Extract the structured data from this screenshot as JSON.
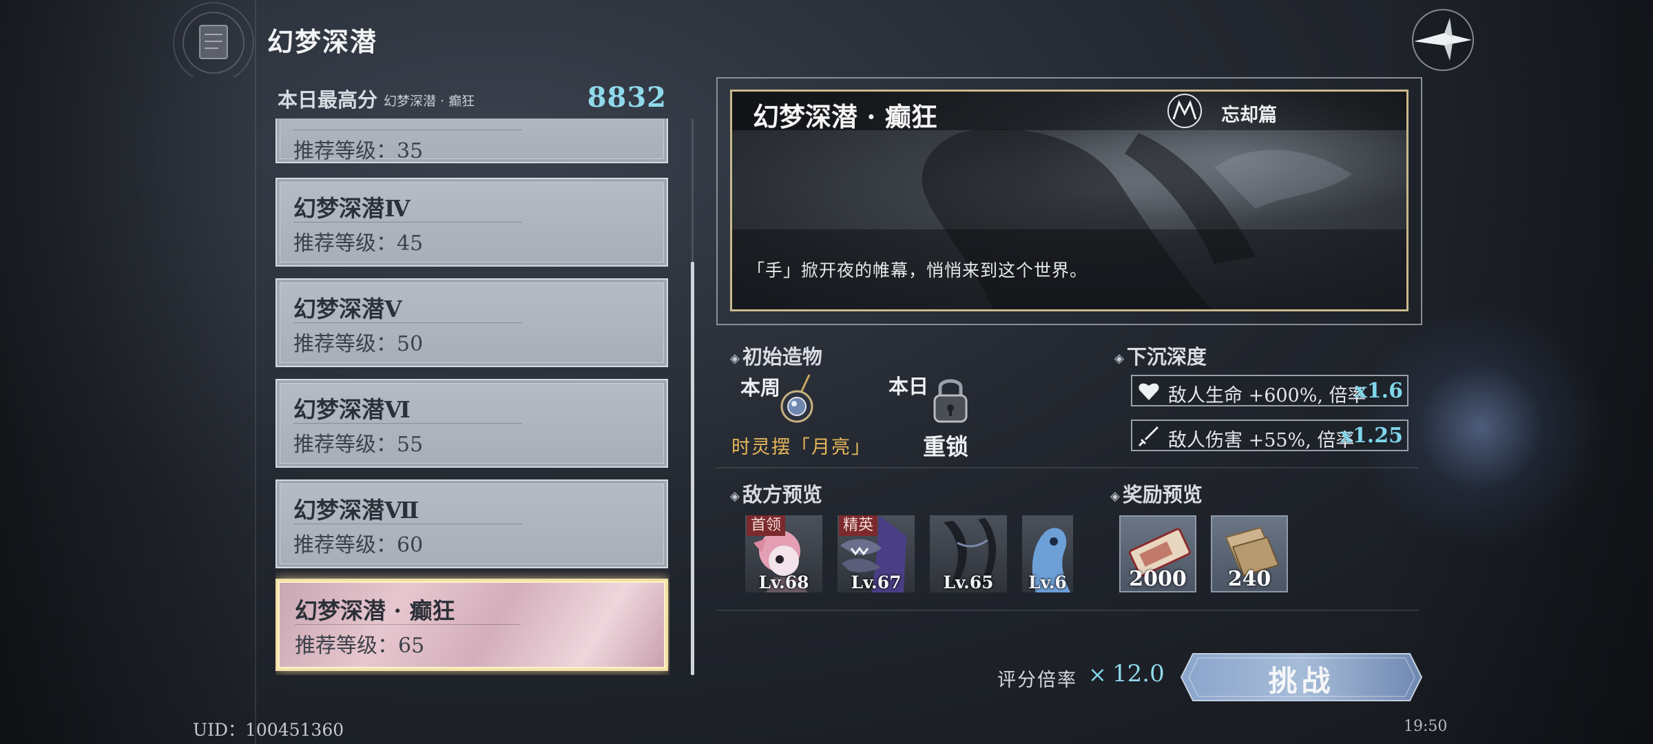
{
  "header": {
    "title": "幻梦深潜",
    "emblem_icon": "book-emblem-icon",
    "back_icon": "compass-back-icon"
  },
  "best_score": {
    "label": "本日最高分",
    "mode": "幻梦深潜 · 癫狂",
    "value": "8832"
  },
  "levels": [
    {
      "name": "",
      "level": "推荐等级：35"
    },
    {
      "name": "幻梦深潜Ⅳ",
      "level": "推荐等级：45"
    },
    {
      "name": "幻梦深潜Ⅴ",
      "level": "推荐等级：50"
    },
    {
      "name": "幻梦深潜Ⅵ",
      "level": "推荐等级：55"
    },
    {
      "name": "幻梦深潜Ⅶ",
      "level": "推荐等级：60"
    },
    {
      "name": "幻梦深潜 · 癫狂",
      "level": "推荐等级：65",
      "selected": true
    }
  ],
  "detail": {
    "title": "幻梦深潜 · 癫狂",
    "chapter": "忘却篇",
    "description": "「手」掀开夜的帷幕，悄悄来到这个世界。"
  },
  "artifacts": {
    "title": "初始造物",
    "weekly_label": "本周",
    "weekly_name": "时灵摆「月亮」",
    "daily_label": "本日",
    "daily_name": "重锁"
  },
  "depth": {
    "title": "下沉深度",
    "modifiers": [
      {
        "icon": "heart-icon",
        "text": "敌人生命 +600%, 倍率",
        "mult": "x1.6"
      },
      {
        "icon": "sword-icon",
        "text": "敌人伤害 +55%, 倍率",
        "mult": "x1.25"
      }
    ]
  },
  "enemies": {
    "title": "敌方预览",
    "items": [
      {
        "tag": "首领",
        "level": "Lv.68"
      },
      {
        "tag": "精英",
        "level": "Lv.67"
      },
      {
        "tag": "",
        "level": "Lv.65"
      },
      {
        "tag": "",
        "level": "Lv.6"
      }
    ]
  },
  "rewards": {
    "title": "奖励预览",
    "items": [
      {
        "qty": "2000"
      },
      {
        "qty": "240"
      }
    ]
  },
  "score_multiplier": {
    "label": "评分倍率",
    "x": "×",
    "value": "12.0"
  },
  "challenge_button": "挑战",
  "uid": "UID：100451360",
  "clock": "19:50",
  "colors": {
    "accent_cyan": "#8fd9ea",
    "gold": "#e6b85a",
    "selected_border": "#f3e2a8",
    "tag_red": "#7c2a2d"
  }
}
